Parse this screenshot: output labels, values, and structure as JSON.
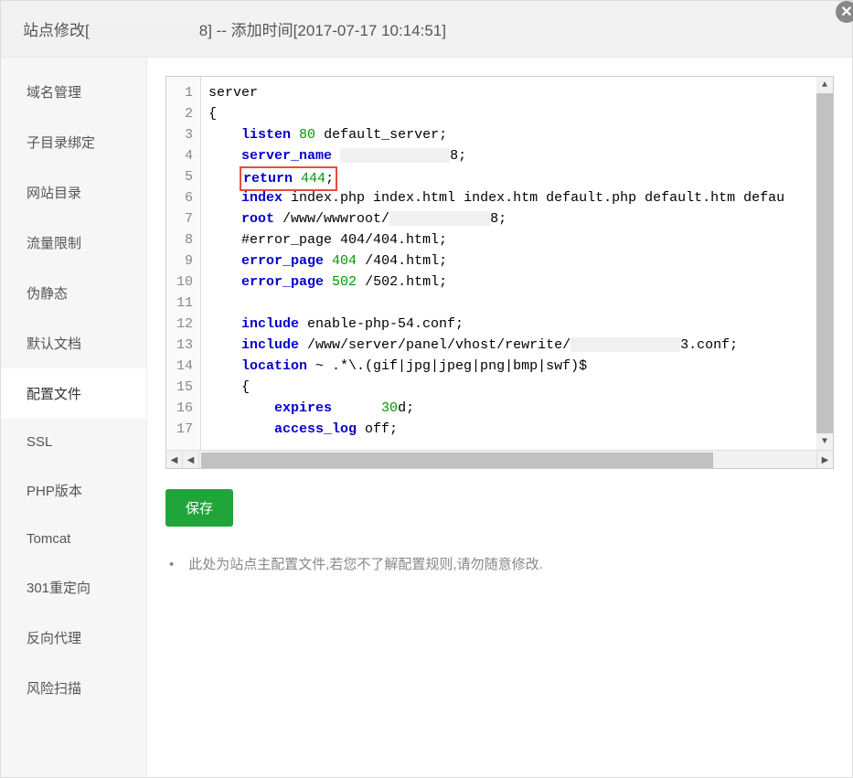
{
  "header": {
    "title_prefix": "站点修改[",
    "title_site_redacted": "          ",
    "title_site_suffix": "8] -- 添加时间[2017-07-17 10:14:51]"
  },
  "sidebar": {
    "items": [
      {
        "label": "域名管理"
      },
      {
        "label": "子目录绑定"
      },
      {
        "label": "网站目录"
      },
      {
        "label": "流量限制"
      },
      {
        "label": "伪静态"
      },
      {
        "label": "默认文档"
      },
      {
        "label": "配置文件"
      },
      {
        "label": "SSL"
      },
      {
        "label": "PHP版本"
      },
      {
        "label": "Tomcat"
      },
      {
        "label": "301重定向"
      },
      {
        "label": "反向代理"
      },
      {
        "label": "风险扫描"
      }
    ],
    "active_index": 6
  },
  "editor": {
    "line_count": 17,
    "lines": [
      {
        "n": 1,
        "indent": 0,
        "text": "server"
      },
      {
        "n": 2,
        "indent": 0,
        "text": "{"
      },
      {
        "n": 3,
        "indent": 1,
        "keyword": "listen",
        "rest_pre": " ",
        "num": "80",
        "rest_post": " default_server;"
      },
      {
        "n": 4,
        "indent": 1,
        "keyword": "server_name",
        "rest_pre": " ",
        "redact_width": 120,
        "rest_post": "8;"
      },
      {
        "n": 5,
        "indent": 1,
        "highlight": true,
        "keyword": "return",
        "rest_pre": " ",
        "num": "444",
        "rest_post": ";"
      },
      {
        "n": 6,
        "indent": 1,
        "keyword": "index",
        "rest_pre": " index.php index.html index.htm default.php default.htm defau"
      },
      {
        "n": 7,
        "indent": 1,
        "keyword": "root",
        "rest_pre": " /www/wwwroot/",
        "redact_width": 110,
        "rest_post": "8;"
      },
      {
        "n": 8,
        "indent": 1,
        "text": "#error_page 404/404.html;"
      },
      {
        "n": 9,
        "indent": 1,
        "keyword": "error_page",
        "rest_pre": " ",
        "num": "404",
        "rest_post": " /404.html;"
      },
      {
        "n": 10,
        "indent": 1,
        "keyword": "error_page",
        "rest_pre": " ",
        "num": "502",
        "rest_post": " /502.html;"
      },
      {
        "n": 11,
        "indent": 0,
        "text": ""
      },
      {
        "n": 12,
        "indent": 1,
        "keyword": "include",
        "rest_pre": " enable-php-54.conf;"
      },
      {
        "n": 13,
        "indent": 1,
        "keyword": "include",
        "rest_pre": " /www/server/panel/vhost/rewrite/",
        "redact_width": 120,
        "rest_post": "3.conf;"
      },
      {
        "n": 14,
        "indent": 1,
        "keyword": "location",
        "rest_pre": " ~ .*\\.(gif|jpg|jpeg|png|bmp|swf)$"
      },
      {
        "n": 15,
        "indent": 1,
        "text": "{"
      },
      {
        "n": 16,
        "indent": 2,
        "keyword": "expires",
        "rest_pre": "      ",
        "num": "30",
        "rest_post": "d;"
      },
      {
        "n": 17,
        "indent": 2,
        "keyword": "access_log",
        "rest_pre": " off;"
      }
    ]
  },
  "buttons": {
    "save": "保存"
  },
  "note": "此处为站点主配置文件,若您不了解配置规则,请勿随意修改."
}
